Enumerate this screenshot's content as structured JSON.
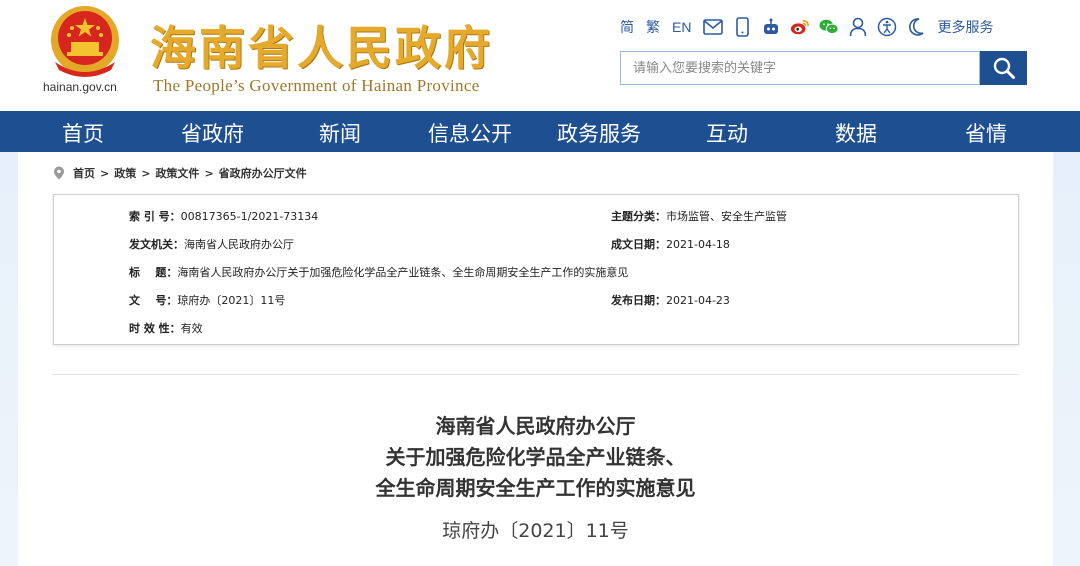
{
  "header": {
    "site_url": "hainan.gov.cn",
    "title_cn": "海南省人民政府",
    "title_en": "The People’s Government  of Hainan Province",
    "lang_simplified": "简",
    "lang_traditional": "繁",
    "lang_english": "EN",
    "more_services": "更多服务",
    "search_placeholder": "请输入您要搜索的关键字",
    "icons": [
      "mail-icon",
      "mobile-icon",
      "robot-icon",
      "weibo-icon",
      "wechat-icon",
      "user-icon",
      "accessibility-icon",
      "elder-mode-icon"
    ]
  },
  "nav": {
    "items": [
      "首页",
      "省政府",
      "新闻",
      "信息公开",
      "政务服务",
      "互动",
      "数据",
      "省情"
    ]
  },
  "breadcrumb": {
    "items": [
      "首页",
      ">",
      "政策",
      ">",
      "政策文件",
      ">",
      "省政府办公厅文件"
    ]
  },
  "meta": {
    "index_label": "索 引 号：",
    "index_value": "00817365-1/2021-73134",
    "topic_label": "主题分类：",
    "topic_value": "市场监管、安全生产监管",
    "issuer_label": "发文机关：",
    "issuer_value": "海南省人民政府办公厅",
    "created_label": "成文日期：",
    "created_value": "2021-04-18",
    "title_label": "标    题：",
    "title_value": "海南省人民政府办公厅关于加强危险化学品全产业链条、全生命周期安全生产工作的实施意见",
    "docno_label": "文    号：",
    "docno_value": "琼府办〔2021〕11号",
    "published_label": "发布日期：",
    "published_value": "2021-04-23",
    "validity_label": "时 效 性：",
    "validity_value": "有效"
  },
  "document": {
    "title_line1": "海南省人民政府办公厅",
    "title_line2": "关于加强危险化学品全产业链条、",
    "title_line3": "全生命周期安全生产工作的实施意见",
    "number": "琼府办〔2021〕11号"
  },
  "colors": {
    "nav_bg": "#1d4f91",
    "title_gold": "#e5a92c",
    "link_blue": "#2c5aa0"
  }
}
